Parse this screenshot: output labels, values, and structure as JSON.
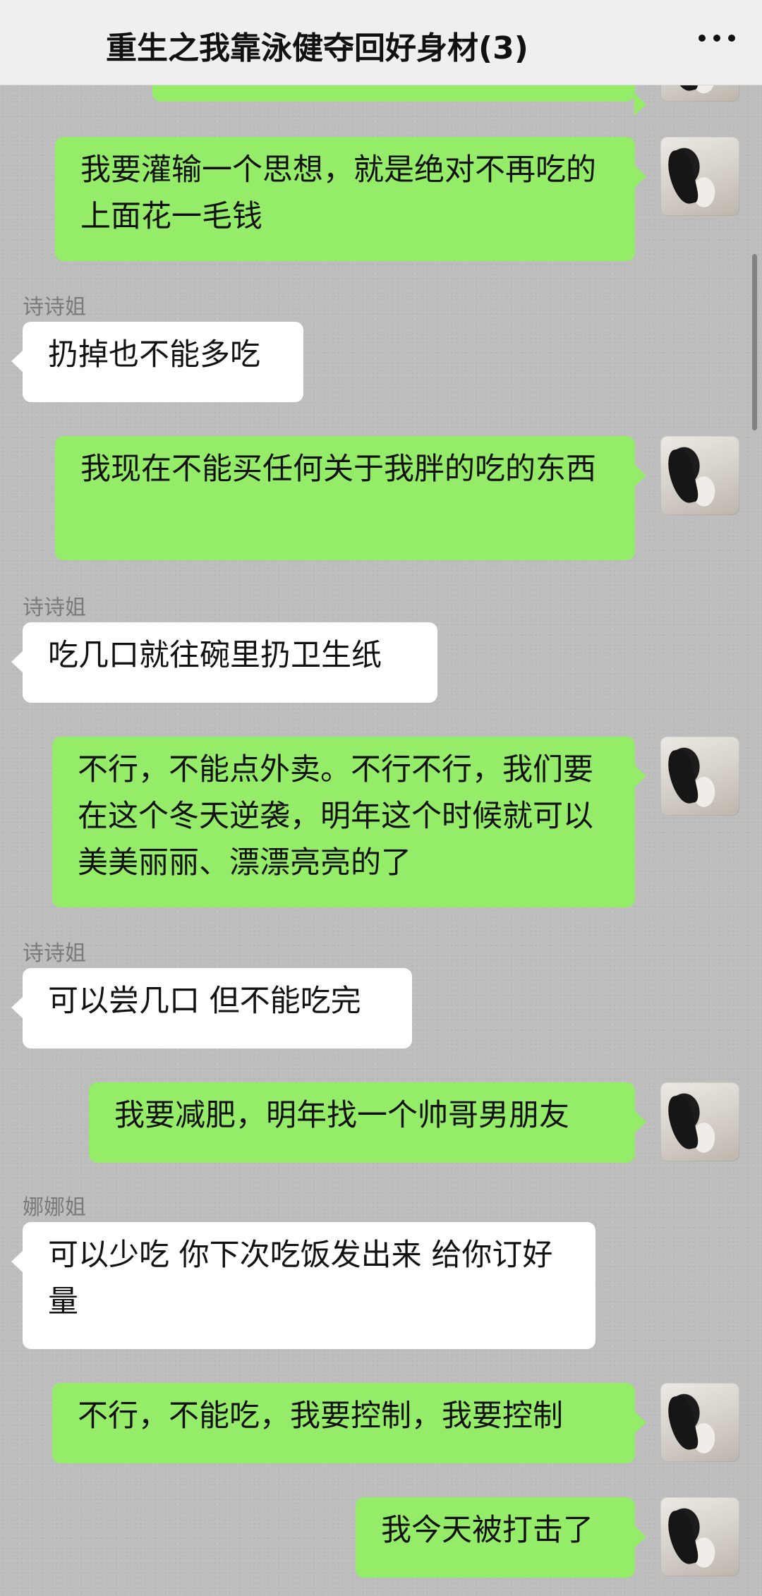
{
  "chat": {
    "title": "重生之我靠泳健夺回好身材(3)",
    "more_icon": "more-dots-icon"
  },
  "messages": [
    {
      "from": "me",
      "text": "我要灌输一个思想，就是绝对不再吃的上面花一毛钱"
    },
    {
      "from": "other",
      "sender": "诗诗姐",
      "text": "扔掉也不能多吃"
    },
    {
      "from": "me",
      "text": "我现在不能买任何关于我胖的吃的东西"
    },
    {
      "from": "other",
      "sender": "诗诗姐",
      "text": "吃几口就往碗里扔卫生纸"
    },
    {
      "from": "me",
      "text": "不行，不能点外卖。不行不行，我们要在这个冬天逆袭，明年这个时候就可以美美丽丽、漂漂亮亮的了"
    },
    {
      "from": "other",
      "sender": "诗诗姐",
      "text": "可以尝几口 但不能吃完"
    },
    {
      "from": "me",
      "text": "我要减肥，明年找一个帅哥男朋友"
    },
    {
      "from": "other",
      "sender": "娜娜姐",
      "text": "可以少吃  你下次吃饭发出来 给你订好量"
    },
    {
      "from": "me",
      "text": "不行，不能吃，我要控制，我要控制"
    },
    {
      "from": "me",
      "text": "我今天被打击了"
    }
  ]
}
